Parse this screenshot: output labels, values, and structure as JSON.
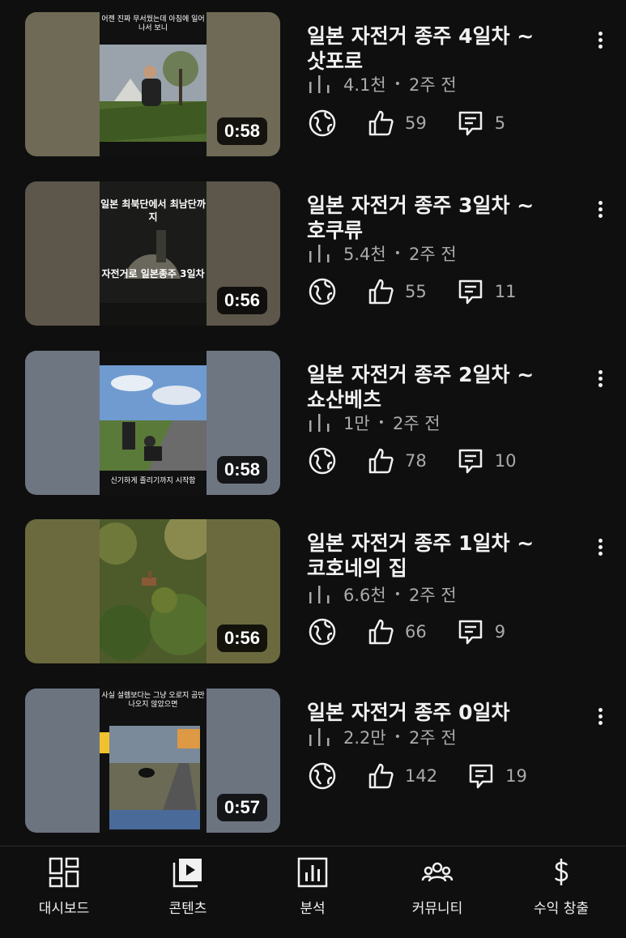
{
  "videos": [
    {
      "title": "일본 자전거 종주 4일차 ~삿포로",
      "views": "4.1천",
      "age": "2주 전",
      "likes": "59",
      "comments": "5",
      "duration": "0:58",
      "thumb_caption": "어젠 진짜 무서웠는데 아침에 일어나서 보니",
      "thumb_bg": "#6f6a55"
    },
    {
      "title": "일본 자전거 종주 3일차 ~호쿠류",
      "views": "5.4천",
      "age": "2주 전",
      "likes": "55",
      "comments": "11",
      "duration": "0:56",
      "thumb_caption_top": "일본 최북단에서 최남단까지",
      "thumb_caption_bottom": "자전거로 일본종주 3일차",
      "thumb_bg": "#5c574a"
    },
    {
      "title": "일본 자전거 종주 2일차 ~쇼산베츠",
      "views": "1만",
      "age": "2주 전",
      "likes": "78",
      "comments": "10",
      "duration": "0:58",
      "thumb_caption": "신기하게 졸리기까지 시작함",
      "thumb_bg": "#6e7682"
    },
    {
      "title": "일본 자전거 종주 1일차 ~코호네의 집",
      "views": "6.6천",
      "age": "2주 전",
      "likes": "66",
      "comments": "9",
      "duration": "0:56",
      "thumb_bg": "#6b6a3e"
    },
    {
      "title": "일본 자전거 종주 0일차",
      "views": "2.2만",
      "age": "2주 전",
      "likes": "142",
      "comments": "19",
      "duration": "0:57",
      "thumb_caption": "사실 설렘보다는 그냥 오로지 곰만 나오지 않았으면",
      "thumb_bg": "#6c7480"
    }
  ],
  "nav": [
    {
      "label": "대시보드",
      "icon": "dashboard-icon"
    },
    {
      "label": "콘텐츠",
      "icon": "content-icon"
    },
    {
      "label": "분석",
      "icon": "analytics-icon"
    },
    {
      "label": "커뮤니티",
      "icon": "community-icon"
    },
    {
      "label": "수익 창출",
      "icon": "earn-icon"
    }
  ]
}
